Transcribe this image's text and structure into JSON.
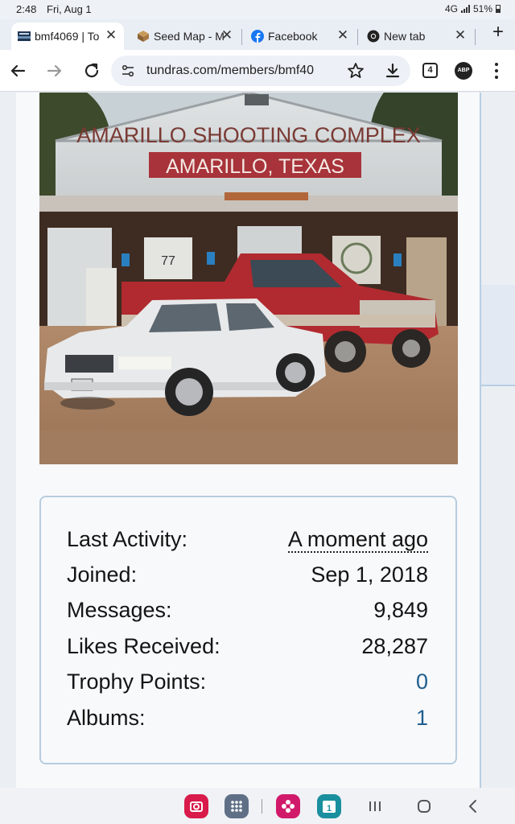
{
  "status_bar": {
    "time": "2:48",
    "date": "Fri, Aug 1",
    "network": "4G",
    "battery": "51%"
  },
  "tabs": [
    {
      "title": "bmf4069 | To",
      "favicon": "tundras-favicon",
      "active": true
    },
    {
      "title": "Seed Map - M",
      "favicon": "seed-map-favicon",
      "active": false
    },
    {
      "title": "Facebook",
      "favicon": "facebook-favicon",
      "active": false
    },
    {
      "title": "New tab",
      "favicon": "chrome-favicon",
      "active": false
    }
  ],
  "toolbar": {
    "url": "tundras.com/members/bmf40",
    "tab_count": "4",
    "adblock_label": "ABP"
  },
  "photo": {
    "sign_line1": "AMARILLO SHOOTING COMPLEX",
    "sign_line2": "AMARILLO, TEXAS",
    "door_sign": "77"
  },
  "stats": [
    {
      "label": "Last Activity:",
      "value": "A moment ago",
      "style": "dotted"
    },
    {
      "label": "Joined:",
      "value": "Sep 1, 2018",
      "style": "plain"
    },
    {
      "label": "Messages:",
      "value": "9,849",
      "style": "plain"
    },
    {
      "label": "Likes Received:",
      "value": "28,287",
      "style": "plain"
    },
    {
      "label": "Trophy Points:",
      "value": "0",
      "style": "link"
    },
    {
      "label": "Albums:",
      "value": "1",
      "style": "link"
    }
  ],
  "nav_bar": {
    "calendar_day": "1",
    "apps": [
      "camera-app-icon",
      "app-drawer-icon",
      "gallery-app-icon",
      "calendar-app-icon"
    ]
  },
  "colors": {
    "link": "#1f5e8e",
    "card_border": "#b7cddf",
    "facebook": "#1877f2"
  }
}
